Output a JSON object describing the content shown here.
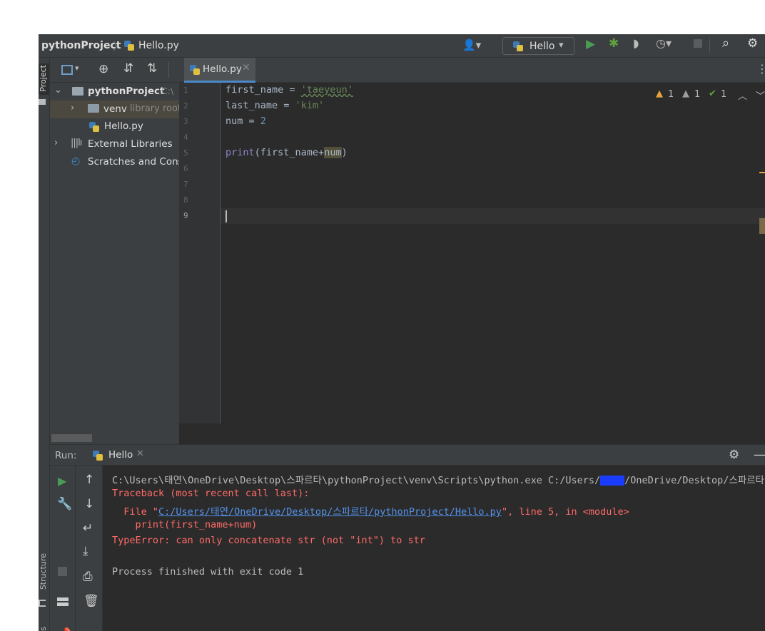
{
  "breadcrumb": {
    "project": "pythonProject",
    "file": "Hello.py"
  },
  "run_config": {
    "name": "Hello"
  },
  "side_tabs": {
    "project": "Project",
    "structure": "Structure",
    "bookmarks": "marks"
  },
  "project_tree": {
    "root": {
      "name": "pythonProject",
      "path": "C:\\"
    },
    "venv": {
      "name": "venv",
      "hint": "library root"
    },
    "file": {
      "name": "Hello.py"
    },
    "libs": {
      "name": "External Libraries"
    },
    "scratches": {
      "name": "Scratches and Consoles"
    }
  },
  "editor": {
    "tab_label": "Hello.py",
    "line_numbers": [
      "1",
      "2",
      "3",
      "4",
      "5",
      "6",
      "7",
      "8",
      "9"
    ],
    "lines": [
      {
        "a": "first_name = ",
        "b": "'taeyeun'"
      },
      {
        "a": "last_name = ",
        "b": "'kim'"
      },
      {
        "a": "num = ",
        "b": "2"
      },
      {
        "a": "",
        "b": ""
      },
      {
        "fn": "print",
        "arg1": "(first_name+",
        "arg2": "num",
        "arg3": ")"
      }
    ],
    "inspections": {
      "warnings": "1",
      "weak_warnings": "1",
      "typos": "1"
    }
  },
  "run": {
    "label": "Run:",
    "tab_label": "Hello",
    "console": {
      "cmd_prefix": "C:\\Users\\태연\\OneDrive\\Desktop\\스파르타\\pythonProject\\venv\\Scripts\\python.exe C:/Users/",
      "cmd_suffix": "/OneDrive/Desktop/스파르타/p",
      "traceback": "Traceback (most recent call last):",
      "file_prefix": "  File \"",
      "file_link": "C:/Users/태연/OneDrive/Desktop/스파르타/pythonProject/Hello.py",
      "file_suffix": "\", line 5, in <module>",
      "code": "    print(first_name+num)",
      "error": "TypeError: can only concatenate str (not \"int\") to str",
      "exit": "Process finished with exit code 1"
    }
  },
  "colors": {
    "accent_green": "#499c54",
    "warning": "#e8a33e",
    "error_red": "#ff6b68",
    "link_blue": "#5394ec"
  }
}
